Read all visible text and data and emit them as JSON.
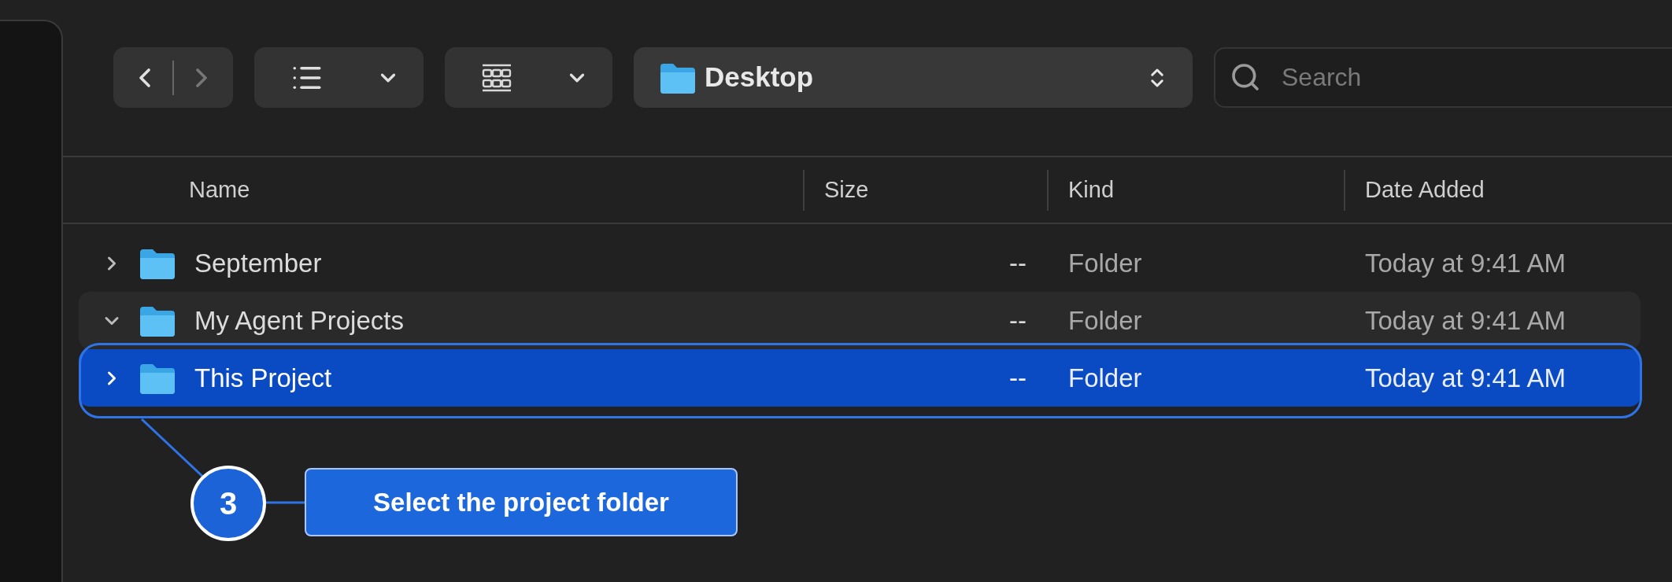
{
  "toolbar": {
    "navigation": {
      "back_disabled": false,
      "forward_disabled": true
    },
    "path": "Desktop",
    "search": {
      "placeholder": "Search"
    }
  },
  "columns": [
    "Name",
    "Size",
    "Kind",
    "Date Added"
  ],
  "rows": [
    {
      "name": "September",
      "size": "--",
      "kind": "Folder",
      "date_added": "Today at 9:41 AM",
      "expanded": false,
      "selected": false
    },
    {
      "name": "My Agent Projects",
      "size": "--",
      "kind": "Folder",
      "date_added": "Today at 9:41 AM",
      "expanded": true,
      "selected": false
    },
    {
      "name": "This Project",
      "size": "--",
      "kind": "Folder",
      "date_added": "Today at 9:41 AM",
      "expanded": false,
      "selected": true
    }
  ],
  "annotation": {
    "step": "3",
    "label": "Select the project folder"
  }
}
